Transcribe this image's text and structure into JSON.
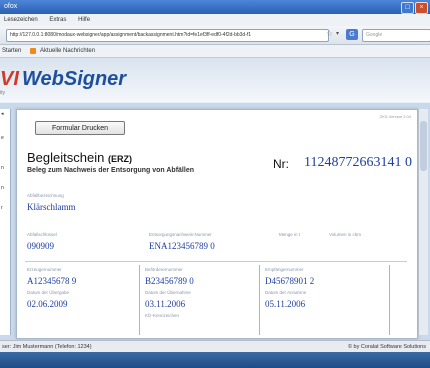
{
  "window": {
    "title": "ofox"
  },
  "menubar": {
    "items": [
      "Lesezeichen",
      "Extras",
      "Hilfe"
    ]
  },
  "navbar": {
    "url": "http://127.0.0.1:8080/modaux-websigner/app/assignment/backassignment.htm?id=fe1ef3ff-edf0-4f2d-bb3d-f1",
    "search_placeholder": "Google"
  },
  "bookmarks": {
    "item1": "Starten",
    "item2": "Aktuelle Nachrichten"
  },
  "app": {
    "logo_prefix": "VI",
    "logo_text": "WebSigner",
    "logo_sub": "ity"
  },
  "sidebar_strip": {
    "items": [
      "e",
      "n",
      "n",
      "r"
    ]
  },
  "form": {
    "version": "ZKS-Version 2.04",
    "print_button": "Formular Drucken",
    "title": "Begleitschein",
    "title_suffix": "(ERZ)",
    "subtitle": "Beleg zum Nachweis der Entsorgung von Abfällen",
    "nr_label": "Nr:",
    "nr_value": "11248772663141 0",
    "abfall_label": "Abfallbezeichnung",
    "abfall_value": "Klärschlamm",
    "schluessel_label": "Abfallschlüssel",
    "schluessel_value": "090909",
    "entsorgungsnachweis_label": "Entsorgungsnachweis-Nummer",
    "entsorgungsnachweis_value": "ENA123456789 0",
    "menge_label": "Menge in t",
    "volumen_label": "Volumen in cbm",
    "erzeuger_label": "Erzeugernummer",
    "erzeuger_value": "A12345678 9",
    "befoerderer_label": "Beförderernummer",
    "befoerderer_value": "B23456789 0",
    "empfaenger_label": "Empfängernummer",
    "empfaenger_value": "D45678901 2",
    "uebergabe_label": "Datum der Übergabe",
    "uebergabe_value": "02.06.2009",
    "uebernahme_label": "Datum der Übernahme",
    "uebernahme_value": "03.11.2006",
    "annahme_label": "Datum der Annahme",
    "annahme_value": "05.11.2006",
    "kfz_label": "Kfz-Kennzeichen"
  },
  "statusbar": {
    "left": "ser: Jim Mustermann (Telefon: 1234)",
    "right": "© by Coralat Software Solutions"
  }
}
